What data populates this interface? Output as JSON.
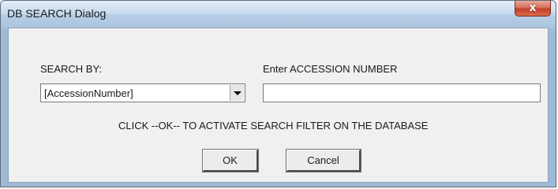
{
  "window": {
    "title": "DB SEARCH Dialog",
    "close_glyph": "x"
  },
  "form": {
    "search_by_label": "SEARCH BY:",
    "search_by_value": "[AccessionNumber]",
    "enter_label": "Enter ACCESSION NUMBER",
    "input_value": "",
    "instruction": "CLICK --OK-- TO  ACTIVATE SEARCH FILTER ON THE DATABASE"
  },
  "buttons": {
    "ok": "OK",
    "cancel": "Cancel"
  },
  "icons": {
    "close": "close-icon",
    "dropdown": "chevron-down-icon"
  }
}
